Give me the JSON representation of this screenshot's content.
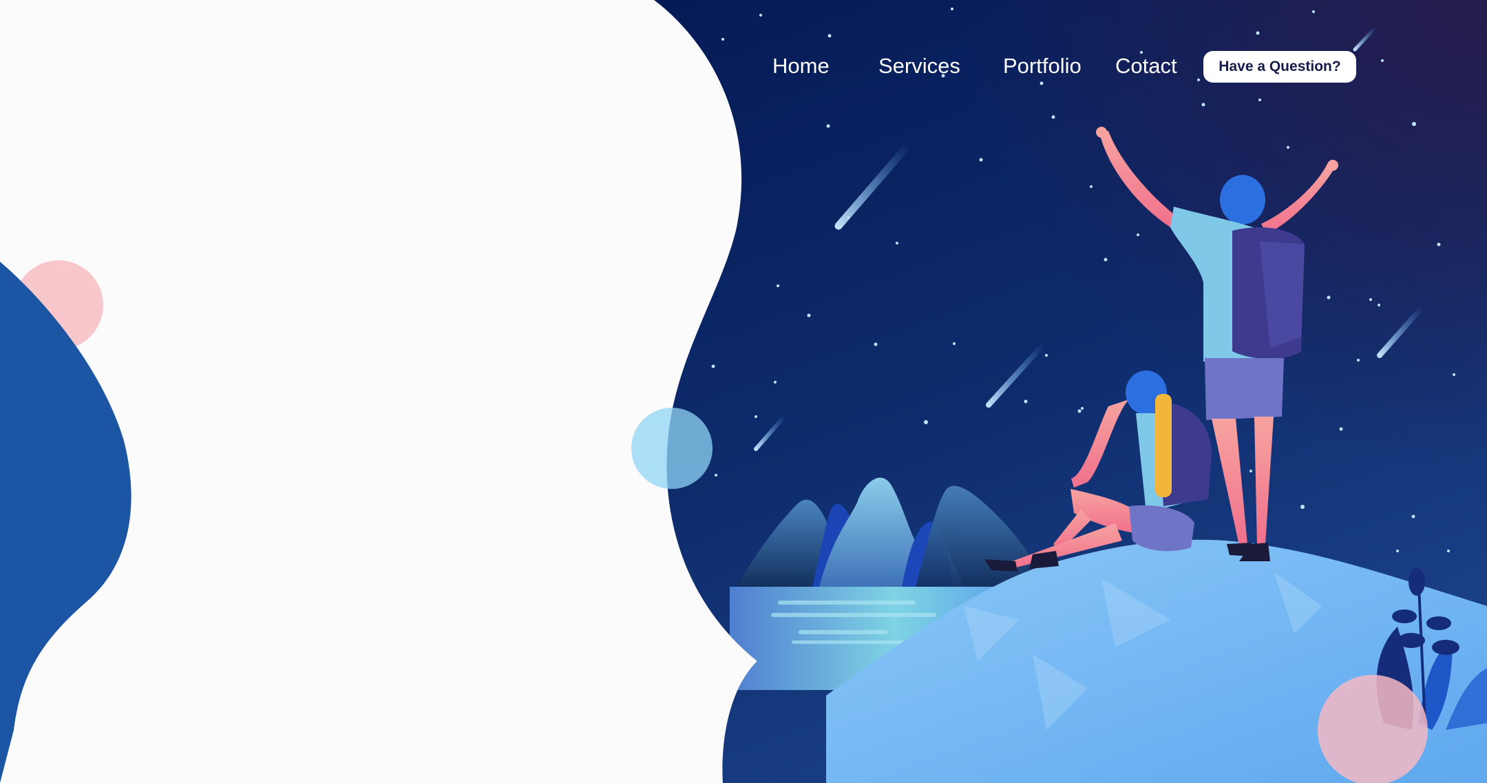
{
  "nav": {
    "links": [
      {
        "label": "Home"
      },
      {
        "label": "Services"
      },
      {
        "label": "Portfolio"
      },
      {
        "label": "Cotact"
      }
    ],
    "cta_label": "Have a Question?"
  },
  "colors": {
    "sky_top": "#0a1f5c",
    "sky_bottom": "#1a3a7a",
    "hill": "#6fb6f3",
    "blob_blue": "#1b55a3",
    "pink_circle": "#f6c3c9",
    "light_blue_circle": "#8fd6f6",
    "cta_text": "#141c4a"
  },
  "illustration": {
    "subject": "two-hikers-on-hilltop-under-starry-sky"
  }
}
